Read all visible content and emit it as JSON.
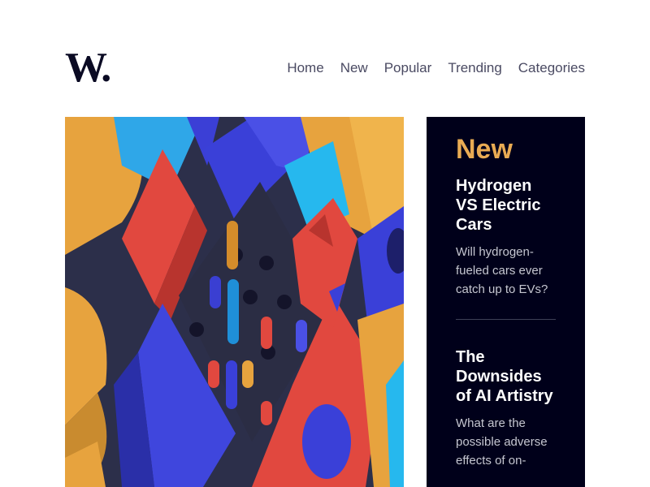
{
  "brand": {
    "logo_text": "W."
  },
  "nav": {
    "items": [
      "Home",
      "New",
      "Popular",
      "Trending",
      "Categories"
    ]
  },
  "hero": {
    "image_description": "abstract 3D shapes"
  },
  "new_panel": {
    "title": "New",
    "articles": [
      {
        "title": "Hydrogen VS Electric Cars",
        "summary": "Will hydrogen-fueled cars ever catch up to EVs?"
      },
      {
        "title": "The Downsides of AI Artistry",
        "summary": "What are the possible adverse effects of on-"
      }
    ]
  },
  "colors": {
    "accent": "#e9ab53",
    "panel_bg": "#00001a",
    "text_dark": "#0a0a23",
    "nav_text": "#4a4a62"
  }
}
